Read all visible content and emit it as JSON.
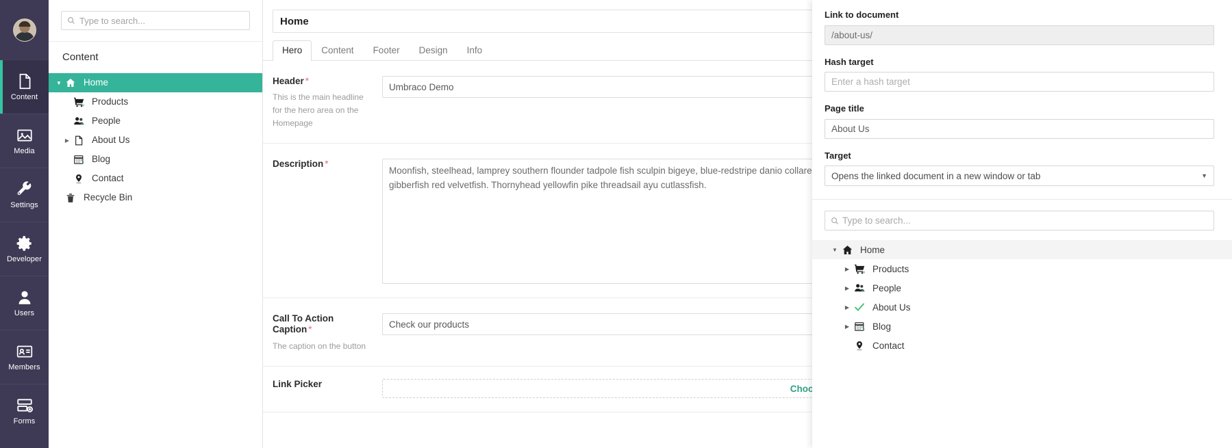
{
  "rail": {
    "avatar_name": "user-avatar",
    "items": [
      {
        "label": "Content",
        "icon": "document-icon",
        "active": true
      },
      {
        "label": "Media",
        "icon": "image-icon",
        "active": false
      },
      {
        "label": "Settings",
        "icon": "wrench-icon",
        "active": false
      },
      {
        "label": "Developer",
        "icon": "gear-icon",
        "active": false
      },
      {
        "label": "Users",
        "icon": "user-icon",
        "active": false
      },
      {
        "label": "Members",
        "icon": "id-card-icon",
        "active": false
      },
      {
        "label": "Forms",
        "icon": "forms-icon",
        "active": false
      }
    ]
  },
  "tree_panel": {
    "search_placeholder": "Type to search...",
    "heading": "Content",
    "nodes": [
      {
        "label": "Home",
        "icon": "home-icon",
        "caret": "down",
        "selected": true,
        "level": 0
      },
      {
        "label": "Products",
        "icon": "cart-icon",
        "caret": "none",
        "selected": false,
        "level": 1
      },
      {
        "label": "People",
        "icon": "people-icon",
        "caret": "none",
        "selected": false,
        "level": 1
      },
      {
        "label": "About Us",
        "icon": "document-icon",
        "caret": "right",
        "selected": false,
        "level": 1
      },
      {
        "label": "Blog",
        "icon": "calendar-icon",
        "caret": "none",
        "selected": false,
        "level": 1
      },
      {
        "label": "Contact",
        "icon": "pin-icon",
        "caret": "none",
        "selected": false,
        "level": 1
      },
      {
        "label": "Recycle Bin",
        "icon": "trash-icon",
        "caret": "none",
        "selected": false,
        "level": 0
      }
    ]
  },
  "editor": {
    "title": "Home",
    "tabs": [
      {
        "label": "Hero",
        "active": true
      },
      {
        "label": "Content",
        "active": false
      },
      {
        "label": "Footer",
        "active": false
      },
      {
        "label": "Design",
        "active": false
      },
      {
        "label": "Info",
        "active": false
      }
    ],
    "fields": {
      "header": {
        "name": "Header",
        "required": "*",
        "description": "This is the main headline for the hero area on the Homepage",
        "value": "Umbraco Demo"
      },
      "description": {
        "name": "Description",
        "required": "*",
        "value": "Moonfish, steelhead, lamprey southern flounder tadpole fish sculpin bigeye, blue-redstripe danio collared dogfish. Smalleye squaretail goldfish arowana butterflyfish pipefish wolf-herring jewel tetra, shiner; gibberfish red velvetfish. Thornyhead yellowfin pike threadsail ayu cutlassfish."
      },
      "call_to_action": {
        "name": "Call To Action Caption",
        "required": "*",
        "description": "The caption on the button",
        "value": "Check our products"
      },
      "link_picker": {
        "name": "Link Picker",
        "choose_label": "Choose"
      }
    }
  },
  "right_panel": {
    "link_to_document": {
      "label": "Link to document",
      "value": "/about-us/"
    },
    "hash_target": {
      "label": "Hash target",
      "placeholder": "Enter a hash target",
      "value": ""
    },
    "page_title": {
      "label": "Page title",
      "value": "About Us"
    },
    "target": {
      "label": "Target",
      "selected": "Opens the linked document in a new window or tab"
    },
    "search_placeholder": "Type to search...",
    "tree": [
      {
        "label": "Home",
        "icon": "home-icon",
        "caret": "down",
        "level": 0,
        "highlight": true
      },
      {
        "label": "Products",
        "icon": "cart-icon",
        "caret": "right",
        "level": 1,
        "highlight": false
      },
      {
        "label": "People",
        "icon": "people-icon",
        "caret": "right",
        "level": 1,
        "highlight": false
      },
      {
        "label": "About Us",
        "icon": "check-icon",
        "caret": "right",
        "level": 1,
        "highlight": false
      },
      {
        "label": "Blog",
        "icon": "calendar-icon",
        "caret": "right",
        "level": 1,
        "highlight": false
      },
      {
        "label": "Contact",
        "icon": "pin-icon",
        "caret": "none",
        "level": 1,
        "highlight": false
      }
    ]
  },
  "colors": {
    "rail_bg": "#3e3a55",
    "accent_teal": "#35b49a",
    "active_rail": "#35c4a1",
    "required_red": "#e06c75",
    "choose_green": "#30a186"
  }
}
